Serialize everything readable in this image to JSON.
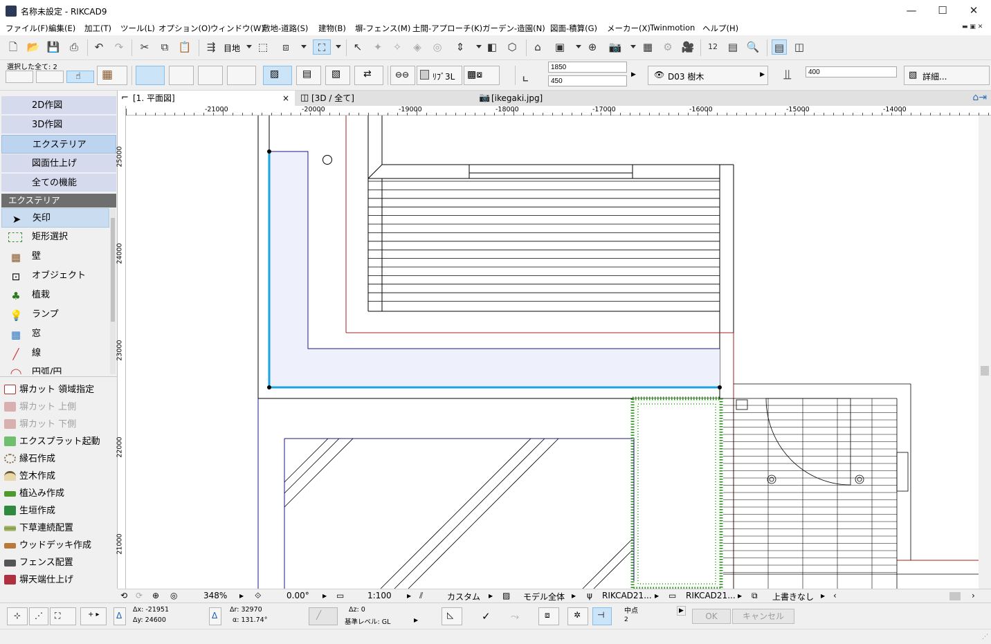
{
  "window": {
    "title": "名称未設定 - RIKCAD9",
    "minimize": "—",
    "maximize": "☐",
    "close": "✕"
  },
  "menu": [
    "ファイル(F)",
    "編集(E)",
    "加工(T)",
    "ツール(L)",
    "オプション(O)",
    "ウィンドウ(W)",
    "敷地-道路(S)",
    "建物(B)",
    "塀-フェンス(M)",
    "土間-アプローチ(K)",
    "ガーデン-造園(N)",
    "図面-積算(G)",
    "メーカー(X)",
    "Twinmotion",
    "ヘルプ(H)"
  ],
  "toolbar1": {
    "layer_label": "目地"
  },
  "toolbar2": {
    "select_all_label": "選択した全て: 2",
    "ref_line_label": "ﾘﾌﾞ3L",
    "height_top": "1850",
    "height_bottom": "450",
    "layer_name": "D03 樹木",
    "elevation": "400",
    "detail_label": "詳細..."
  },
  "tabs": [
    {
      "label": "[1. 平面図]",
      "closable": "×"
    },
    {
      "label": "[3D / 全て]"
    },
    {
      "label": "[ikegaki.jpg]"
    }
  ],
  "palette": {
    "groups": [
      "2D作図",
      "3D作図",
      "エクステリア",
      "図面仕上げ",
      "全ての機能"
    ],
    "section_title": "エクステリア",
    "tools": [
      {
        "label": "矢印",
        "icon": "arrow-icon"
      },
      {
        "label": "矩形選択",
        "icon": "marquee-icon"
      },
      {
        "label": "壁",
        "icon": "wall-icon"
      },
      {
        "label": "オブジェクト",
        "icon": "object-icon"
      },
      {
        "label": "植栽",
        "icon": "tree-icon"
      },
      {
        "label": "ランプ",
        "icon": "lamp-icon"
      },
      {
        "label": "窓",
        "icon": "window-icon"
      },
      {
        "label": "線",
        "icon": "line-icon"
      },
      {
        "label": "円弧/円",
        "icon": "arc-icon"
      }
    ],
    "commands": [
      {
        "label": "塀カット 領域指定",
        "enabled": true
      },
      {
        "label": "塀カット 上側",
        "enabled": false
      },
      {
        "label": "塀カット 下側",
        "enabled": false
      },
      {
        "label": "エクスプラット起動",
        "enabled": true
      },
      {
        "label": "縁石作成",
        "enabled": true
      },
      {
        "label": "笠木作成",
        "enabled": true
      },
      {
        "label": "植込み作成",
        "enabled": true
      },
      {
        "label": "生垣作成",
        "enabled": true
      },
      {
        "label": "下草連続配置",
        "enabled": true
      },
      {
        "label": "ウッドデッキ作成",
        "enabled": true
      },
      {
        "label": "フェンス配置",
        "enabled": true
      },
      {
        "label": "塀天端仕上げ",
        "enabled": true
      }
    ]
  },
  "ruler_top": [
    "-21000",
    "-20000",
    "-19000",
    "-18000",
    "-17000",
    "-16000",
    "-15000",
    "-14000"
  ],
  "ruler_left": [
    "25000",
    "24000",
    "23000",
    "22000",
    "21000"
  ],
  "view_bar": {
    "zoom": "348%",
    "angle": "0.00°",
    "scale": "1:100",
    "structure": "カスタム",
    "model": "モデル全体",
    "pen_set_1": "RIKCAD21...",
    "pen_set_2": "RIKCAD21...",
    "override": "上書きなし"
  },
  "coords": {
    "dx": "Δx: -21951",
    "dy": "Δy: 24600",
    "dr": "Δr: 32970",
    "da": "α: 131.74°",
    "dz": "Δz: 0",
    "ref_level": "基準レベル: GL",
    "snap_label": "中点",
    "snap_value": "2",
    "ok": "OK",
    "cancel": "キャンセル"
  },
  "colors": {
    "selection": "#1aa3e0",
    "fill": "#eef0fb",
    "hedge": "#2d8a1e",
    "red_line": "#a02020",
    "blue_line": "#1a1a8a"
  }
}
